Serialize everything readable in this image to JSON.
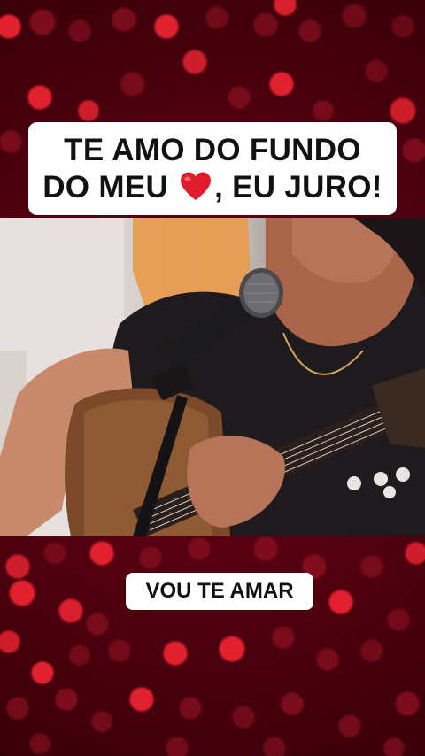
{
  "top_caption": {
    "line1": "TE AMO DO FUNDO",
    "line2_before": "DO MEU ",
    "line2_after": ", EU JURO!",
    "heart_icon": "red-heart-emoji"
  },
  "bottom_caption": {
    "text": "VOU TE AMAR"
  },
  "colors": {
    "background": "#4a0010",
    "bokeh_bright": "#e2212f",
    "bokeh_dim": "#8c1020",
    "caption_bg": "#ffffff",
    "caption_text": "#111111",
    "heart": "#e01b2b"
  }
}
